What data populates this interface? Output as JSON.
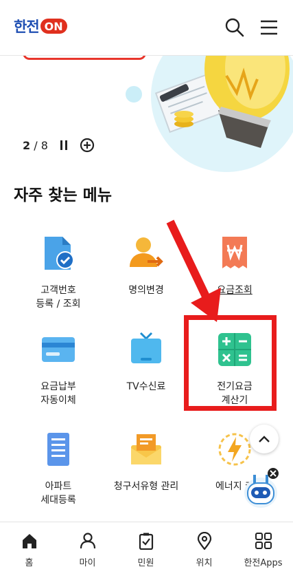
{
  "header": {
    "logo_text": "한전",
    "logo_on": "ON",
    "search_icon": "search-icon",
    "menu_icon": "hamburger-menu-icon"
  },
  "banner": {
    "current_page": "2",
    "separator": "/",
    "total_pages": "8",
    "pause_icon": "pause-icon",
    "add_icon": "plus-circle-icon"
  },
  "section": {
    "title": "자주 찾는 메뉴"
  },
  "menu_items": [
    {
      "label": "고객번호\n등록 / 조회",
      "icon": "customer-number-check-icon"
    },
    {
      "label": "명의변경",
      "icon": "name-change-icon"
    },
    {
      "label": "요금조회",
      "icon": "bill-inquiry-icon"
    },
    {
      "label": "요금납부\n자동이체",
      "icon": "card-payment-icon"
    },
    {
      "label": "TV수신료",
      "icon": "tv-icon"
    },
    {
      "label": "전기요금\n계산기",
      "icon": "calculator-icon"
    },
    {
      "label": "아파트\n세대등록",
      "icon": "apartment-icon"
    },
    {
      "label": "청구서유형 관리",
      "icon": "envelope-icon"
    },
    {
      "label": "에너지 캐",
      "icon": "energy-icon"
    }
  ],
  "tabs": [
    {
      "label": "홈",
      "icon": "home-icon"
    },
    {
      "label": "마이",
      "icon": "user-icon"
    },
    {
      "label": "민원",
      "icon": "clipboard-check-icon"
    },
    {
      "label": "위치",
      "icon": "location-pin-icon"
    },
    {
      "label": "한전Apps",
      "icon": "apps-grid-icon"
    }
  ],
  "colors": {
    "brand_blue": "#1f4fb3",
    "brand_red": "#e0301e",
    "highlight_red": "#e81c1c"
  }
}
